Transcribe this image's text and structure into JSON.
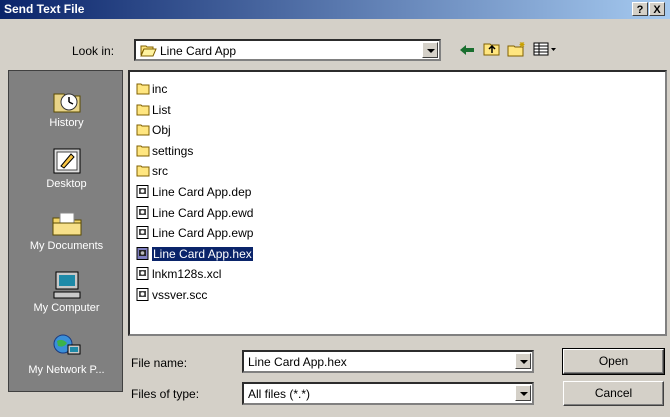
{
  "window": {
    "title": "Send Text File",
    "help": "?",
    "close": "X"
  },
  "toolbar": {
    "look_in_label": "Look in:",
    "look_in_value": "Line Card App"
  },
  "places": [
    {
      "label": "History",
      "icon": "history-icon"
    },
    {
      "label": "Desktop",
      "icon": "desktop-icon"
    },
    {
      "label": "My Documents",
      "icon": "my-documents-icon"
    },
    {
      "label": "My Computer",
      "icon": "my-computer-icon"
    },
    {
      "label": "My Network P...",
      "icon": "my-network-places-icon"
    }
  ],
  "files": [
    {
      "name": "inc",
      "type": "folder"
    },
    {
      "name": "List",
      "type": "folder"
    },
    {
      "name": "Obj",
      "type": "folder"
    },
    {
      "name": "settings",
      "type": "folder"
    },
    {
      "name": "src",
      "type": "folder"
    },
    {
      "name": "Line Card App.dep",
      "type": "file"
    },
    {
      "name": "Line Card App.ewd",
      "type": "file"
    },
    {
      "name": "Line Card App.ewp",
      "type": "file"
    },
    {
      "name": "Line Card App.hex",
      "type": "file",
      "selected": true
    },
    {
      "name": "lnkm128s.xcl",
      "type": "file"
    },
    {
      "name": "vssver.scc",
      "type": "file"
    }
  ],
  "form": {
    "file_name_label": "File name:",
    "file_name_value": "Line Card App.hex",
    "files_of_type_label": "Files of type:",
    "files_of_type_value": "All files (*.*)"
  },
  "buttons": {
    "open": "Open",
    "cancel": "Cancel"
  },
  "colors": {
    "title_start": "#0a246a",
    "title_end": "#a6caf0",
    "face": "#d4d0c8",
    "places_bg": "#808080",
    "selection": "#0a246a"
  }
}
